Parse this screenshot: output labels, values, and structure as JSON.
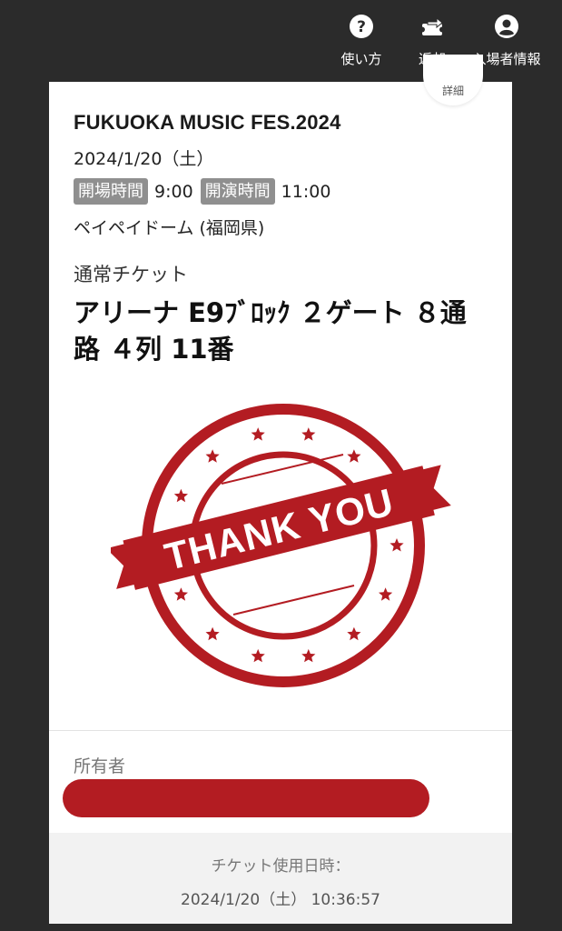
{
  "header": {
    "actions": [
      {
        "icon": "question-circle-icon",
        "label": "使い方"
      },
      {
        "icon": "ticket-return-icon",
        "label": "返却"
      },
      {
        "icon": "account-circle-icon",
        "label": "入場者情報"
      }
    ]
  },
  "ticket": {
    "detail_label": "詳細",
    "event_title": "FUKUOKA MUSIC FES.2024",
    "date": "2024/1/20（土）",
    "open_label": "開場時間",
    "open_time": "9:00",
    "start_label": "開演時間",
    "start_time": "11:00",
    "venue": "ペイペイドーム (福岡県)",
    "ticket_type": "通常チケット",
    "seat": "アリーナ E9ﾌﾞﾛｯｸ ２ゲート ８通路 ４列 11番",
    "stamp_text": "THANK YOU",
    "owner_label": "所有者",
    "used_label": "チケット使用日時：",
    "used_datetime": "2024/1/20（土） 10:36:57"
  },
  "colors": {
    "background": "#2b2b2b",
    "stamp_red": "#b31c22",
    "badge_gray": "#8f8f8f"
  }
}
